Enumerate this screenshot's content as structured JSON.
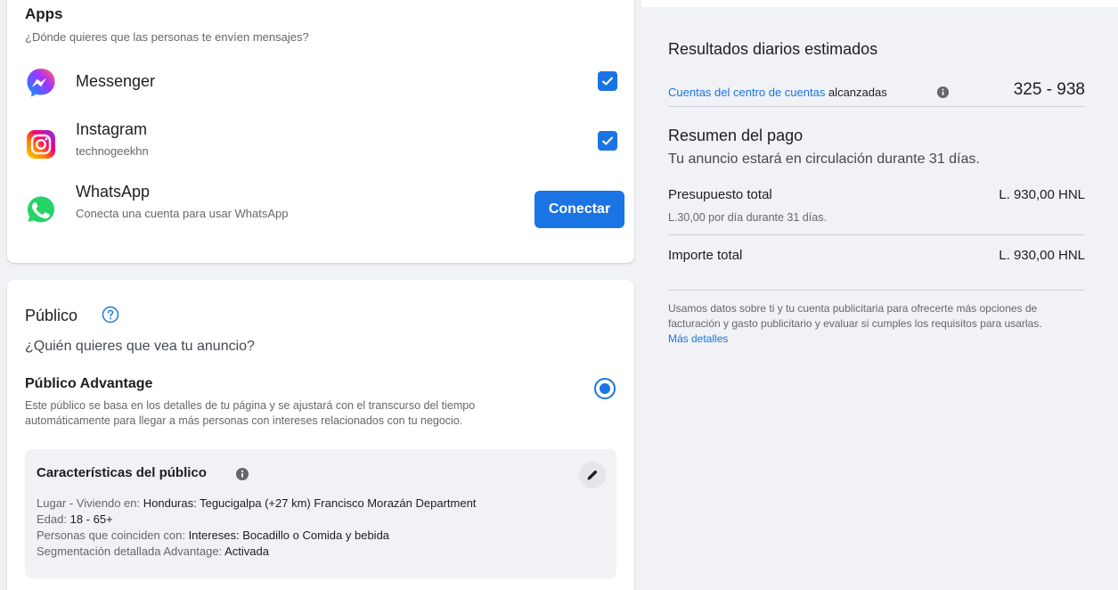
{
  "apps": {
    "title": "Apps",
    "subtitle": "¿Dónde quieres que las personas te envíen mensajes?",
    "items": [
      {
        "name": "Messenger",
        "checked": true,
        "icon": "messenger-icon"
      },
      {
        "name": "Instagram",
        "sub": "technogeekhn",
        "checked": true,
        "icon": "instagram-icon"
      },
      {
        "name": "WhatsApp",
        "sub": "Conecta una cuenta para usar WhatsApp",
        "button": "Conectar",
        "icon": "whatsapp-icon"
      }
    ]
  },
  "public": {
    "title": "Público",
    "question": "¿Quién quieres que vea tu anuncio?",
    "advantage_title": "Público Advantage",
    "advantage_desc": "Este público se basa en los detalles de tu página y se ajustará con el transcurso del tiempo automáticamente para llegar a más personas con intereses relacionados con tu negocio.",
    "characteristics": {
      "title": "Características del público",
      "lines": [
        {
          "label": "Lugar - Viviendo en: ",
          "value": "Honduras: Tegucigalpa (+27 km) Francisco Morazán Department"
        },
        {
          "label": "Edad: ",
          "value": "18 - 65+"
        },
        {
          "label": "Personas que coinciden con: ",
          "value": "Intereses: Bocadillo o Comida y bebida"
        },
        {
          "label": "Segmentación detallada Advantage: ",
          "value": "Activada"
        }
      ]
    }
  },
  "results": {
    "title": "Resultados diarios estimados",
    "accounts_link": "Cuentas del centro de cuentas",
    "accounts_rest": " alcanzadas",
    "range": "325 - 938"
  },
  "payment": {
    "title": "Resumen del pago",
    "subtitle": "Tu anuncio estará en circulación durante 31 días.",
    "budget_label": "Presupuesto total",
    "budget_sub": "L.30,00 por día durante 31 días.",
    "budget_value": "L. 930,00 HNL",
    "total_label": "Importe total",
    "total_value": "L. 930,00 HNL",
    "disclaimer": "Usamos datos sobre ti y tu cuenta publicitaria para ofrecerte más opciones de facturación y gasto publicitario y evaluar si cumples los requisitos para usarlas. ",
    "more_link": "Más detalles"
  },
  "colors": {
    "accent": "#1b74e4",
    "background": "#f0f2f5"
  }
}
